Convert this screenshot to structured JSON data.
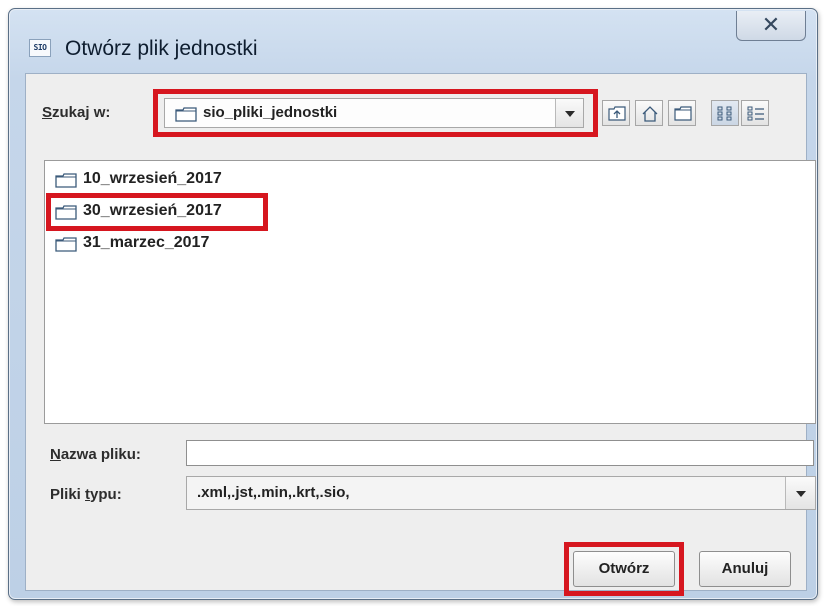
{
  "window": {
    "title": "Otwórz plik jednostki",
    "app_icon_text": "SIO",
    "close_glyph": "✕"
  },
  "lookin": {
    "label_mnemonic": "S",
    "label_rest": "zukaj w:",
    "value": "sio_pliki_jednostki",
    "icon": "folder-icon"
  },
  "toolbar": {
    "buttons": [
      {
        "icon": "up-folder-icon"
      },
      {
        "icon": "home-icon"
      },
      {
        "icon": "new-folder-icon"
      },
      {
        "icon": "list-view-icon",
        "active": true
      },
      {
        "icon": "details-view-icon"
      }
    ]
  },
  "files": [
    {
      "name": "10_wrzesień_2017",
      "icon": "folder-icon"
    },
    {
      "name": "30_wrzesień_2017",
      "icon": "folder-icon",
      "highlighted": true
    },
    {
      "name": "31_marzec_2017",
      "icon": "folder-icon"
    }
  ],
  "filename": {
    "label_mnemonic": "N",
    "label_rest": "azwa pliku:",
    "value": ""
  },
  "filetype": {
    "label_start": "Pliki ",
    "label_mnemonic": "t",
    "label_rest": "ypu:",
    "value": ".xml,.jst,.min,.krt,.sio,"
  },
  "buttons": {
    "open": "Otwórz",
    "cancel": "Anuluj"
  },
  "colors": {
    "highlight": "#d6161f",
    "title_gradient": "#c5d6ea",
    "client_bg": "#eeeeee"
  }
}
